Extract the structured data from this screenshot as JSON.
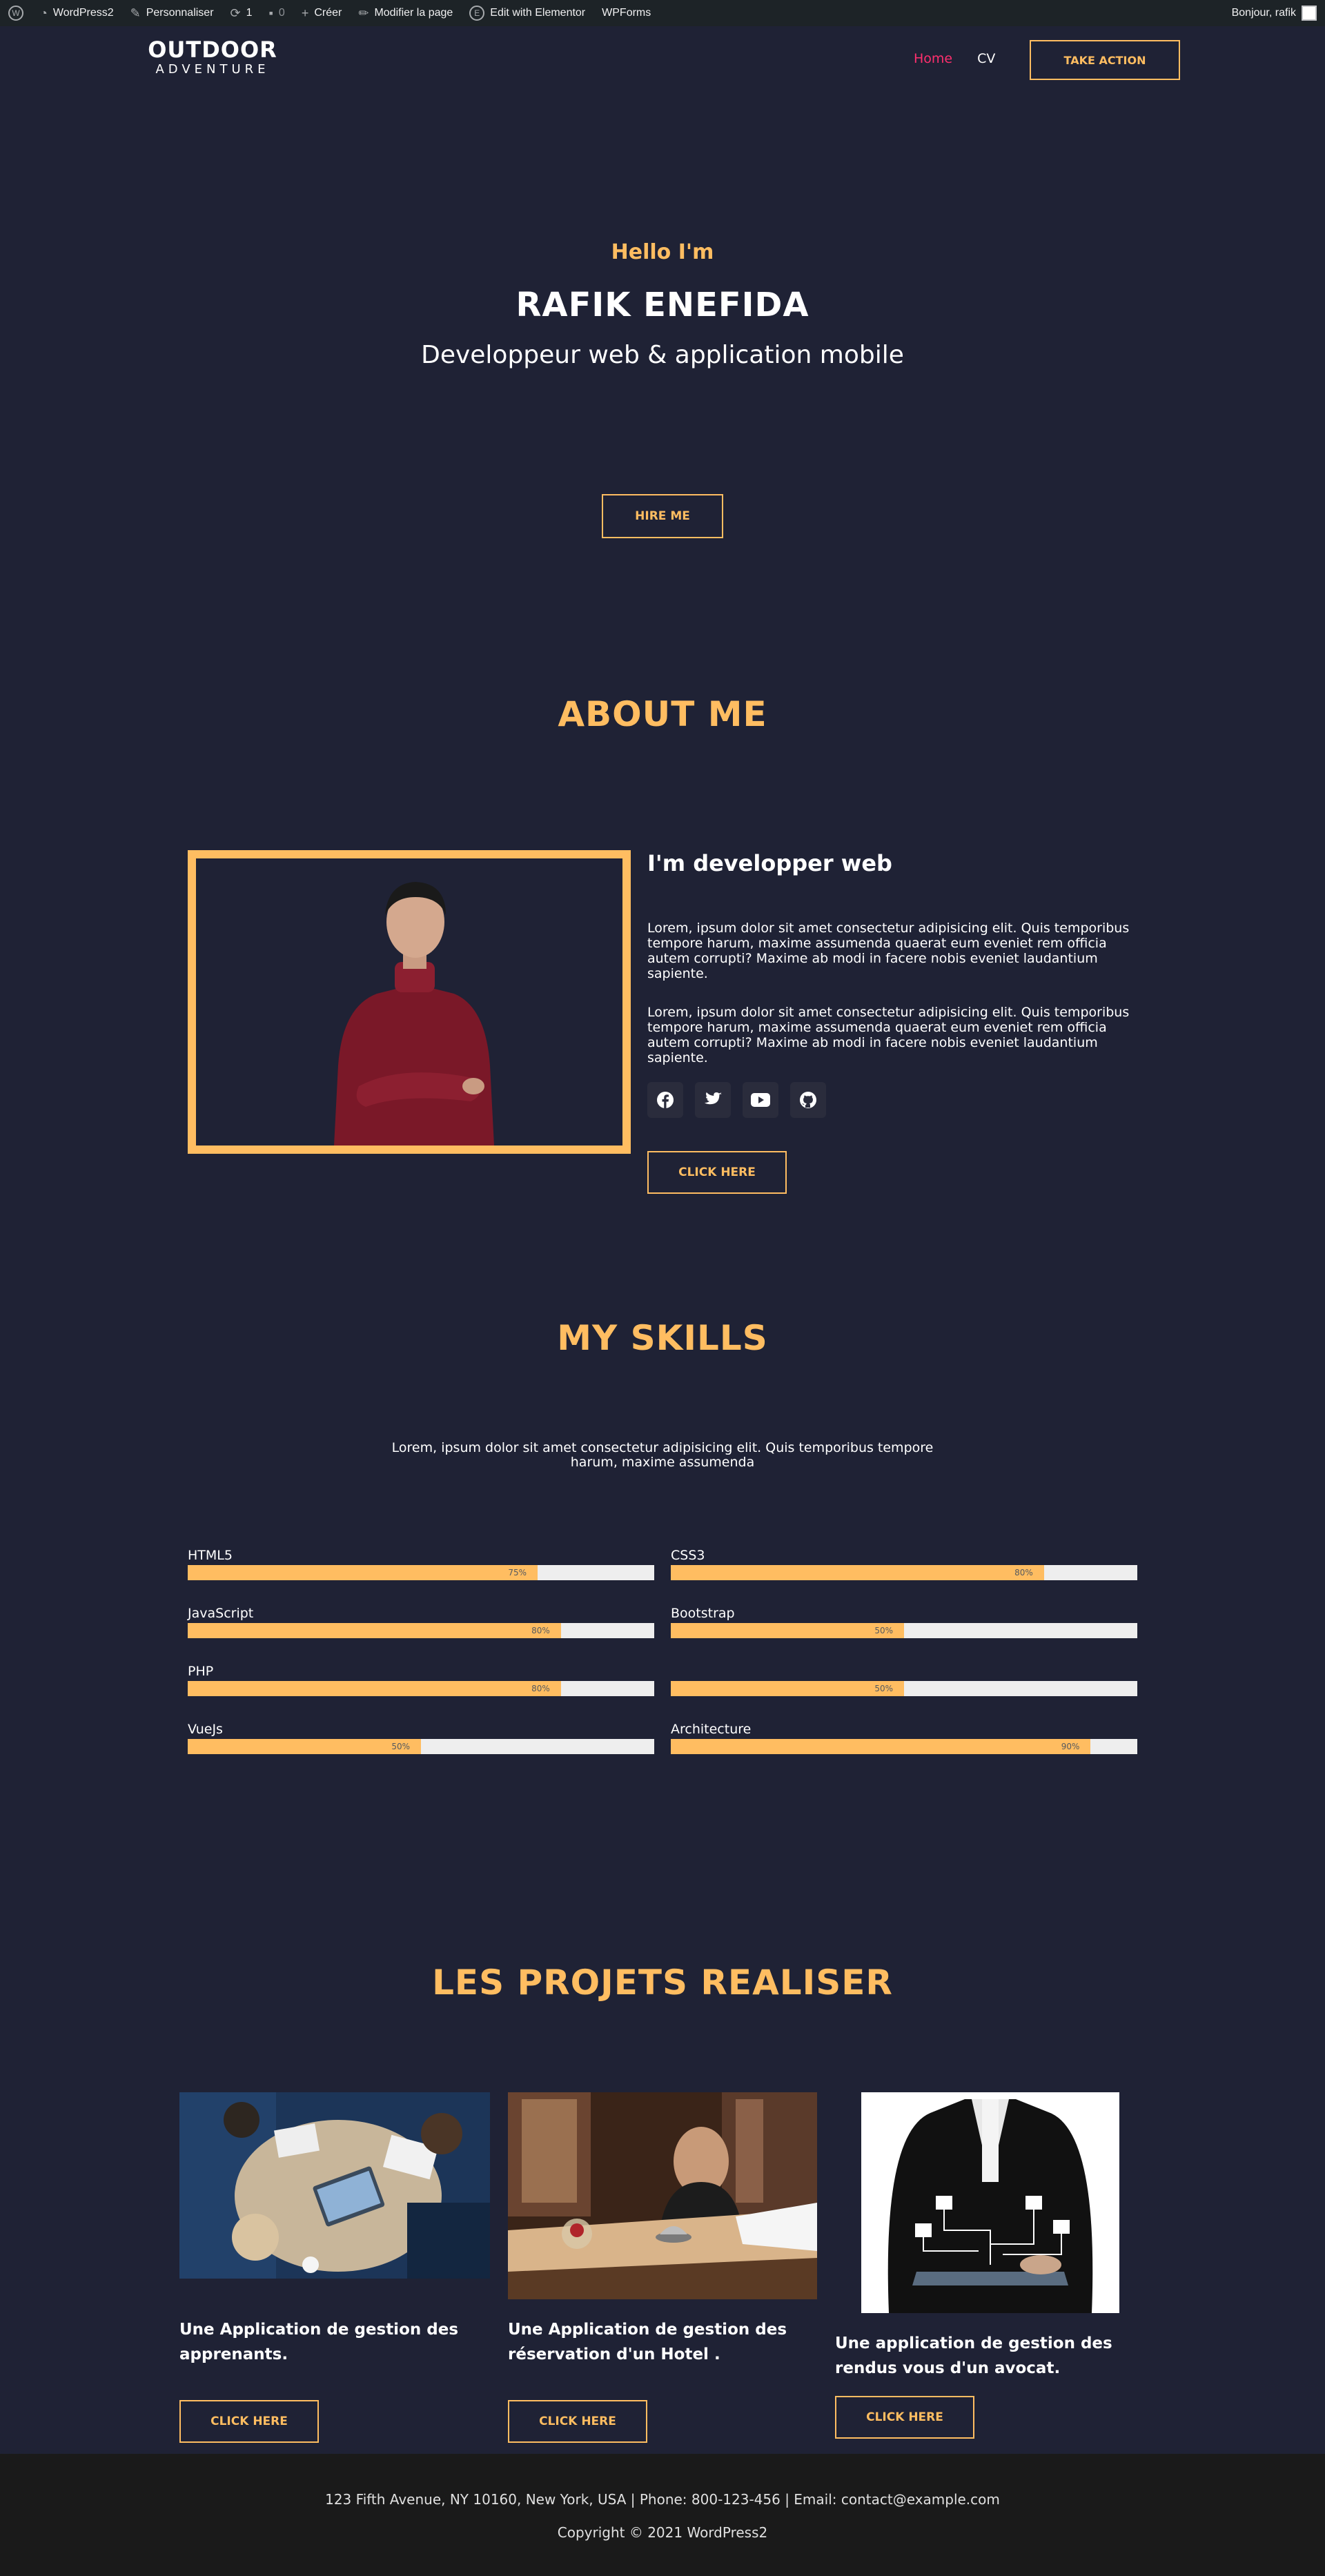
{
  "adminbar": {
    "site": "WordPress2",
    "customize": "Personnaliser",
    "updates": "1",
    "comments": "0",
    "new": "Créer",
    "edit_page": "Modifier la page",
    "elementor": "Edit with Elementor",
    "wpforms": "WPForms",
    "greeting": "Bonjour, rafik"
  },
  "header": {
    "logo_top": "OUTDOOR",
    "logo_bottom": "ADVENTURE",
    "nav": {
      "home": "Home",
      "cv": "CV"
    },
    "cta": "TAKE ACTION"
  },
  "hero": {
    "hello": "Hello I'm",
    "name": "RAFIK ENEFIDA",
    "subtitle": "Developpeur web & application mobile",
    "button": "HIRE ME"
  },
  "about": {
    "title": "ABOUT ME",
    "heading": "I'm developper web",
    "paragraph1": "Lorem, ipsum dolor sit amet consectetur adipisicing elit. Quis temporibus tempore harum, maxime assumenda quaerat eum eveniet rem officia autem corrupti? Maxime ab modi in facere nobis eveniet laudantium sapiente.",
    "paragraph2": "Lorem, ipsum dolor sit amet consectetur adipisicing elit. Quis temporibus tempore harum, maxime assumenda quaerat eum eveniet rem officia autem corrupti? Maxime ab modi in facere nobis eveniet laudantium sapiente.",
    "socials": [
      "facebook-icon",
      "twitter-icon",
      "youtube-icon",
      "github-icon"
    ],
    "button": "CLICK HERE"
  },
  "skills": {
    "title": "MY SKILLS",
    "intro": "Lorem, ipsum dolor sit amet consectetur adipisicing elit. Quis temporibus tempore harum, maxime assumenda",
    "items": [
      {
        "label": "HTML5",
        "percent": "75%",
        "value": 75
      },
      {
        "label": "CSS3",
        "percent": "80%",
        "value": 80
      },
      {
        "label": "JavaScript",
        "percent": "80%",
        "value": 80
      },
      {
        "label": "Bootstrap",
        "percent": "50%",
        "value": 50
      },
      {
        "label": "PHP",
        "percent": "80%",
        "value": 80
      },
      {
        "label": "",
        "percent": "50%",
        "value": 50
      },
      {
        "label": "VueJs",
        "percent": "50%",
        "value": 50
      },
      {
        "label": "Architecture",
        "percent": "90%",
        "value": 90
      }
    ]
  },
  "projects": {
    "title": "LES PROJETS REALISER",
    "items": [
      {
        "title_line1": "Une Application de gestion des",
        "title_line2": "apprenants.",
        "button": "CLICK HERE"
      },
      {
        "title_line1": "Une Application de gestion des",
        "title_line2": "réservation d'un Hotel .",
        "button": "CLICK HERE"
      },
      {
        "title_line1": "Une application de gestion des",
        "title_line2": "rendus vous d'un avocat.",
        "button": "CLICK HERE"
      }
    ]
  },
  "footer": {
    "contact": "123 Fifth Avenue, NY 10160, New York, USA | Phone: 800-123-456 | Email: contact@example.com",
    "copyright": "Copyright © 2021 WordPress2"
  },
  "colors": {
    "background": "#1f2235",
    "accent": "#ffbd61",
    "nav_active": "#ff2f6e",
    "footer_bg": "#1a1a1a"
  }
}
